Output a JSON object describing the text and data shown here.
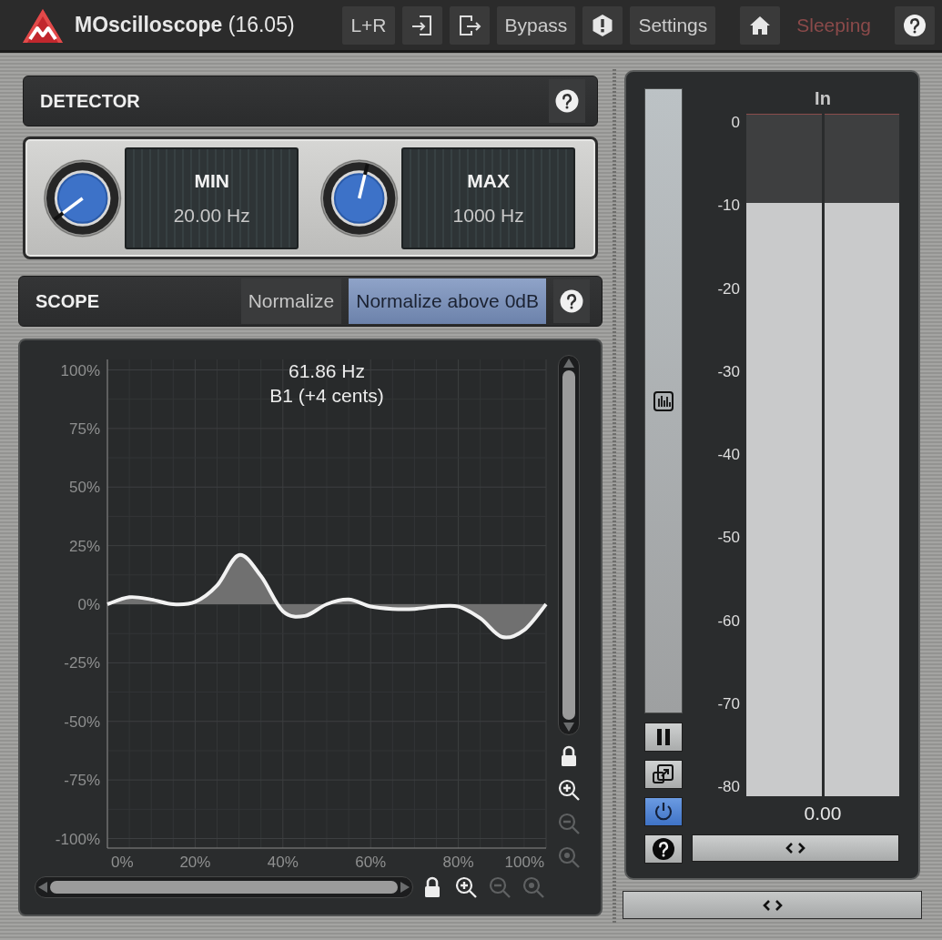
{
  "toolbar": {
    "title": "**MOscilloscope** (16.05)",
    "items": [
      {
        "kind": "text",
        "label": "L+R"
      },
      {
        "kind": "import"
      },
      {
        "kind": "export"
      },
      {
        "kind": "text",
        "label": "Bypass"
      },
      {
        "kind": "alert"
      },
      {
        "kind": "text",
        "label": "Settings"
      },
      {
        "kind": "home"
      },
      {
        "kind": "status",
        "label": "Sleeping"
      },
      {
        "kind": "help"
      }
    ]
  },
  "detector": {
    "title": "DETECTOR",
    "params": [
      {
        "label": "MIN",
        "value": "20.00 Hz",
        "level": 0.03
      },
      {
        "label": "MAX",
        "value": "1000 Hz",
        "level": 0.55
      }
    ]
  },
  "scope": {
    "title": "SCOPE",
    "modes": [
      {
        "label": "Normalize",
        "selected": false
      },
      {
        "label": "Normalize above 0dB",
        "selected": true
      }
    ]
  },
  "oscilloscope": {
    "frequency": "61.86 Hz",
    "note": "B1 (+4 cents)",
    "chart_data": {
      "type": "area",
      "x": [
        0,
        5,
        10,
        15,
        20,
        25,
        30,
        35,
        40,
        45,
        50,
        55,
        60,
        65,
        70,
        75,
        80,
        85,
        90,
        95,
        100
      ],
      "series": [
        {
          "color": "#f2f2f2",
          "values": [
            0,
            3,
            2,
            0,
            1,
            8,
            21,
            12,
            -3,
            -5,
            0,
            2,
            -1,
            -2,
            -2,
            -1,
            -1,
            -6,
            -14,
            -11,
            0
          ]
        }
      ],
      "xlim": [
        0,
        100
      ],
      "ylim": [
        -100,
        100
      ],
      "grid": true,
      "xticks": [
        {
          "value": 0,
          "label": "0%"
        },
        {
          "value": 20,
          "label": "20%"
        },
        {
          "value": 40,
          "label": "40%"
        },
        {
          "value": 60,
          "label": "60%"
        },
        {
          "value": 80,
          "label": "80%"
        },
        {
          "value": 100,
          "label": "100%"
        }
      ],
      "yticks": [
        {
          "value": 100,
          "label": "100%"
        },
        {
          "value": 75,
          "label": "75%"
        },
        {
          "value": 50,
          "label": "50%"
        },
        {
          "value": 25,
          "label": "25%"
        },
        {
          "value": 0,
          "label": "0%"
        },
        {
          "value": -25,
          "label": "-25%"
        },
        {
          "value": -50,
          "label": "-50%"
        },
        {
          "value": -75,
          "label": "-75%"
        },
        {
          "value": -100,
          "label": "-100%"
        }
      ]
    },
    "tools_vertical": [
      {
        "kind": "lock",
        "disabled": false
      },
      {
        "kind": "zoomin",
        "disabled": false
      },
      {
        "kind": "zoomout",
        "disabled": true
      },
      {
        "kind": "zoomreset",
        "disabled": true
      }
    ],
    "tools_horizontal": [
      {
        "kind": "lock",
        "disabled": false
      },
      {
        "kind": "zoomin",
        "disabled": false
      },
      {
        "kind": "zoomout",
        "disabled": true
      },
      {
        "kind": "zoomreset",
        "disabled": true
      }
    ]
  },
  "meter": {
    "title": "In",
    "scale": [
      "0",
      "-10",
      "-20",
      "-30",
      "-40",
      "-50",
      "-60",
      "-70",
      "-80"
    ],
    "channels": [
      {
        "level": 0.87
      },
      {
        "level": 0.87
      }
    ],
    "reading": "0.00",
    "gain_slider": {
      "level": 0.5
    },
    "buttons": [
      {
        "kind": "pause",
        "on": false
      },
      {
        "kind": "expand",
        "on": false
      },
      {
        "kind": "power",
        "on": true
      },
      {
        "kind": "help",
        "on": false
      }
    ]
  }
}
